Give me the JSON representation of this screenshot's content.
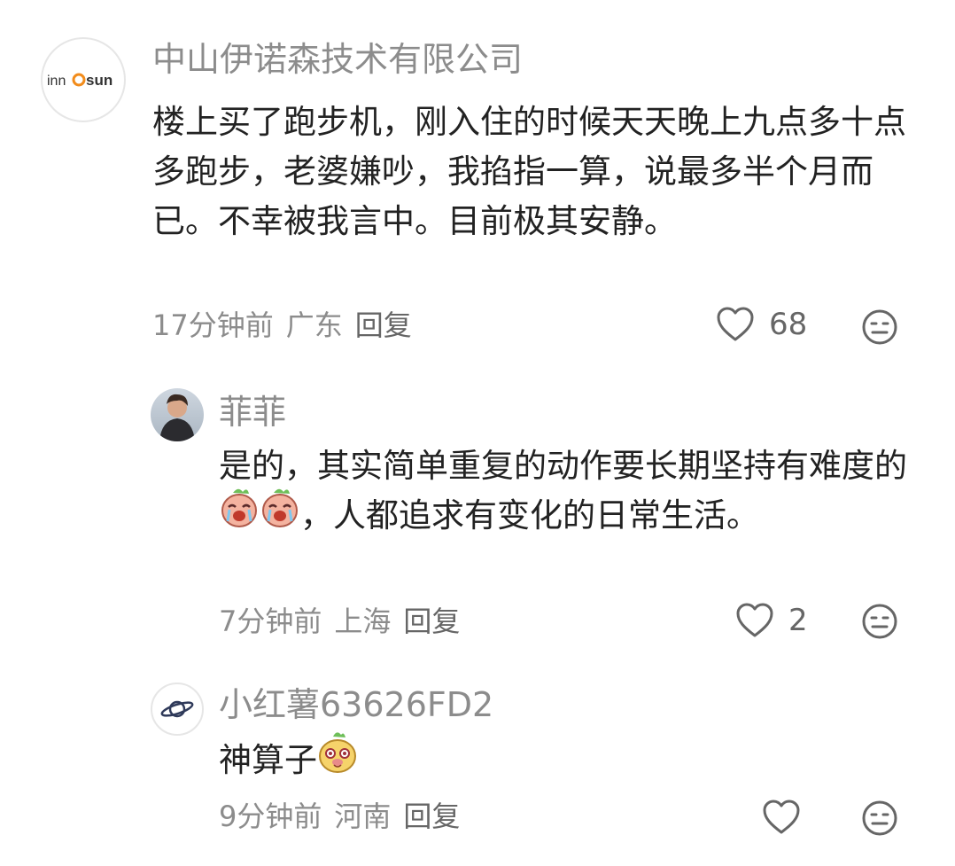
{
  "comments": [
    {
      "username": "中山伊诺森技术有限公司",
      "avatar_text": "inno sun",
      "text": "楼上买了跑步机，刚入住的时候天天晚上九点多十点多跑步，老婆嫌吵，我掐指一算，说最多半个月而已。不幸被我言中。目前极其安静。",
      "time": "17分钟前",
      "location": "广东",
      "reply_label": "回复",
      "likes": "68"
    },
    {
      "username": "菲菲",
      "text_before": "是的，其实简单重复的动作要长期坚持有难度的",
      "text_after": "，人都追求有变化的日常生活。",
      "time": "7分钟前",
      "location": "上海",
      "reply_label": "回复",
      "likes": "2"
    },
    {
      "username": "小红薯63626FD2",
      "text": "神算子",
      "time": "9分钟前",
      "location": "河南",
      "reply_label": "回复"
    }
  ],
  "icons": {
    "like": "heart-outline-icon",
    "dislike": "meh-face-icon",
    "emoji_crying": "crying-peach-emoji",
    "emoji_smile": "smiling-face-emoji"
  },
  "colors": {
    "text": "#222222",
    "meta": "#8c8c8c",
    "avatar_border": "#e6e6e6"
  }
}
